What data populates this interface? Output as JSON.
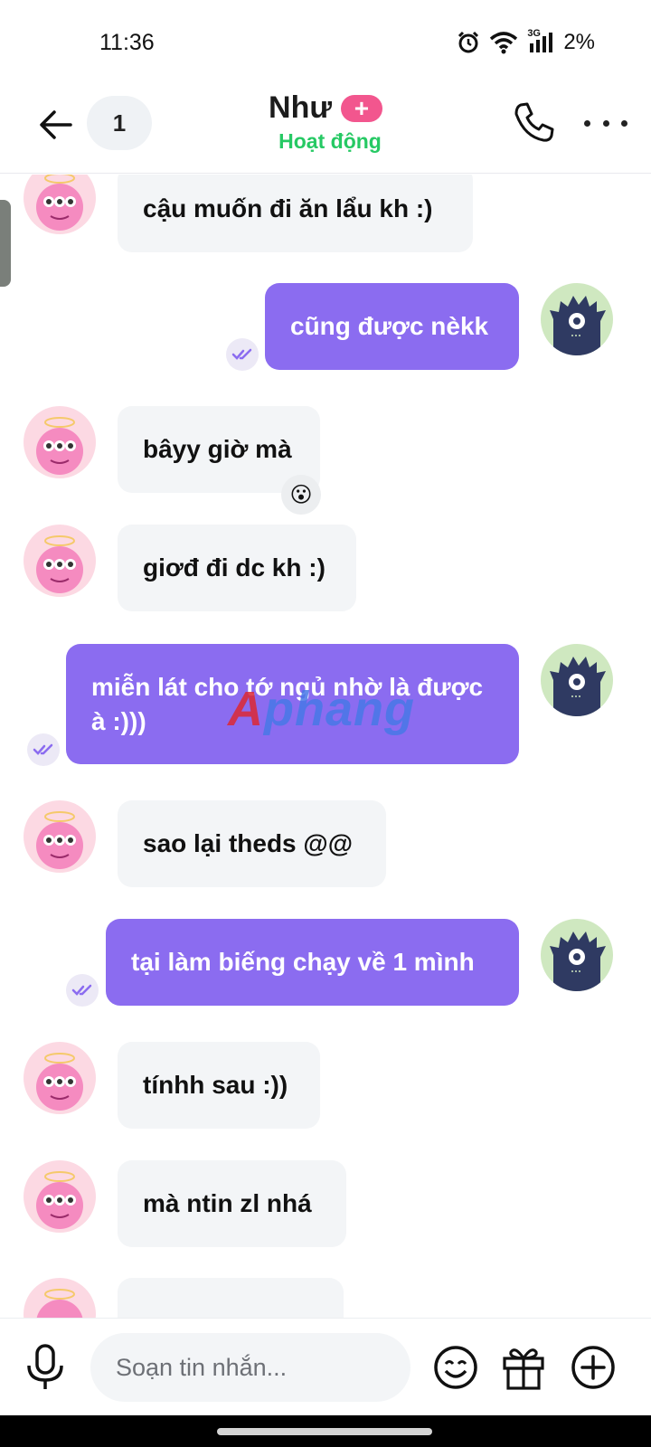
{
  "status_bar": {
    "time": "11:36",
    "network": "3G",
    "battery": "2%"
  },
  "header": {
    "back_icon": "arrow-left-icon",
    "unread_count": "1",
    "contact_name": "Như",
    "add_badge": "+",
    "contact_status": "Hoạt động",
    "status_color": "#26c964",
    "call_icon": "phone-icon",
    "more_icon": "more-horizontal-icon"
  },
  "messages": [
    {
      "direction": "in",
      "text": "cậu muốn đi ăn lẩu kh :)"
    },
    {
      "direction": "out",
      "text": "cũng được nèkk",
      "seen": true
    },
    {
      "direction": "in",
      "text": "bâyy giờ mà",
      "reaction": "😮"
    },
    {
      "direction": "in",
      "text": "giơđ đi dc kh :)"
    },
    {
      "direction": "out",
      "text": "miễn lát cho tớ ngủ nhờ là được à :)))",
      "seen": true
    },
    {
      "direction": "in",
      "text": "sao lại theds @@"
    },
    {
      "direction": "out",
      "text": "tại làm biếng chạy về 1 mình",
      "seen": true
    },
    {
      "direction": "in",
      "text": "tínhh sau :))"
    },
    {
      "direction": "in",
      "text": "mà ntin zl nhá"
    }
  ],
  "watermark": {
    "part_a": "A",
    "part_b": "phang"
  },
  "composer": {
    "placeholder": "Soạn tin nhắn...",
    "value": "",
    "mic_icon": "microphone-icon",
    "emoji_icon": "smiley-icon",
    "gift_icon": "gift-icon",
    "plus_icon": "plus-circle-icon"
  },
  "colors": {
    "outgoing_bubble": "#8b6cf0",
    "incoming_bubble": "#f3f5f7",
    "add_badge": "#f2568e"
  }
}
